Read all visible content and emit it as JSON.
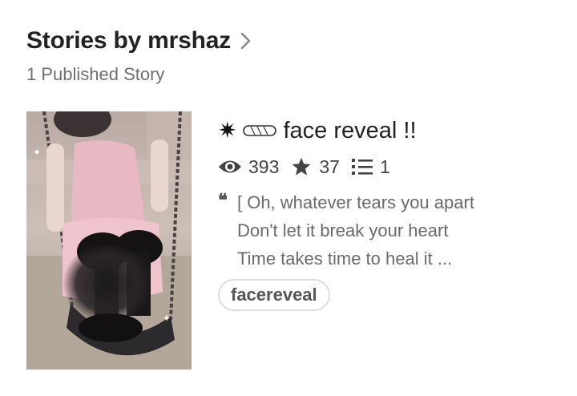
{
  "header": {
    "title": "Stories by mrshaz",
    "subtitle": "1 Published Story"
  },
  "story": {
    "cover_icon": "cover-photo",
    "title_prefix_symbol": "✷",
    "title": "face reveal !!",
    "stats": {
      "reads": "393",
      "votes": "37",
      "parts": "1"
    },
    "description_lines": [
      "[ Oh, whatever tears you apart",
      "Don't let it break your heart",
      "Time takes time to heal it ..."
    ],
    "tag": "facereveal"
  },
  "icons": {
    "chevron": "chevron-right-icon",
    "eye": "eye-icon",
    "star": "star-icon",
    "list": "list-icon",
    "quote": "quote-icon"
  }
}
